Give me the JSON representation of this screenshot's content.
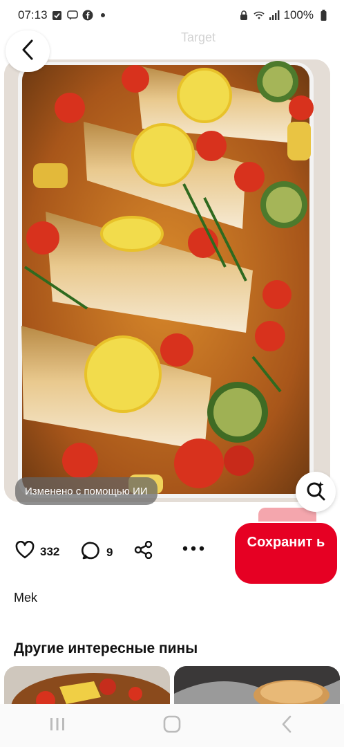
{
  "status_bar": {
    "time": "07:13",
    "battery": "100%"
  },
  "header": {
    "faded_title": "Target"
  },
  "pin": {
    "ai_badge": "Изменено с помощью ИИ",
    "likes": "332",
    "comments": "9",
    "save_label": "Сохранит ь",
    "author": "Mek"
  },
  "more_section": {
    "title": "Другие интересные пины"
  },
  "colors": {
    "accent": "#e60023",
    "badge_bg": "#6e6e6e"
  },
  "icons": [
    "back-arrow-icon",
    "heart-icon",
    "comment-icon",
    "share-icon",
    "more-icon",
    "visual-search-icon",
    "nav-recents-icon",
    "nav-home-icon",
    "nav-back-icon"
  ]
}
